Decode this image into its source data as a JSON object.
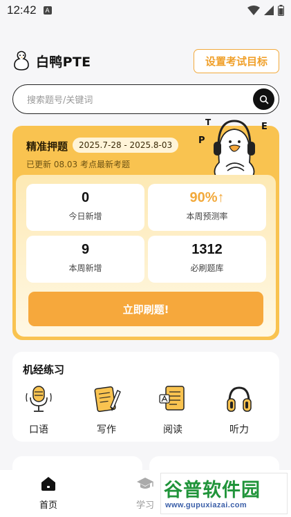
{
  "status_bar": {
    "time": "12:42",
    "notice_icon": "A"
  },
  "header": {
    "app_name": "白鸭PTE",
    "goal_button": "设置考试目标"
  },
  "search": {
    "placeholder": "搜索题号/关键词"
  },
  "prediction": {
    "title": "精准押题",
    "date_range": "2025.7-28 - 2025.8-03",
    "updated_text": "已更新 08.03 考点最新考题",
    "duck_letters": [
      "T",
      "P",
      "E"
    ],
    "stats": [
      {
        "value": "0",
        "label": "今日新增"
      },
      {
        "value": "90%↑",
        "label": "本周预测率"
      },
      {
        "value": "9",
        "label": "本周新增"
      },
      {
        "value": "1312",
        "label": "必刷题库"
      }
    ],
    "cta": "立即刷题!"
  },
  "practice": {
    "title": "机经练习",
    "items": [
      {
        "label": "口语",
        "icon": "microphone-icon"
      },
      {
        "label": "写作",
        "icon": "notebook-pencil-icon"
      },
      {
        "label": "阅读",
        "icon": "document-icon"
      },
      {
        "label": "听力",
        "icon": "headphones-icon"
      }
    ]
  },
  "bottom_nav": {
    "items": [
      {
        "label": "首页",
        "icon": "home-icon",
        "active": true
      },
      {
        "label": "学习",
        "icon": "graduation-cap-icon",
        "active": false
      }
    ]
  },
  "watermark": {
    "main": "谷普软件园",
    "url": "www.gupuxiazai.com"
  },
  "colors": {
    "accent": "#f2a93b",
    "card_yellow": "#f9c350",
    "cta_orange": "#f6a83c",
    "watermark_green": "#20943a"
  }
}
